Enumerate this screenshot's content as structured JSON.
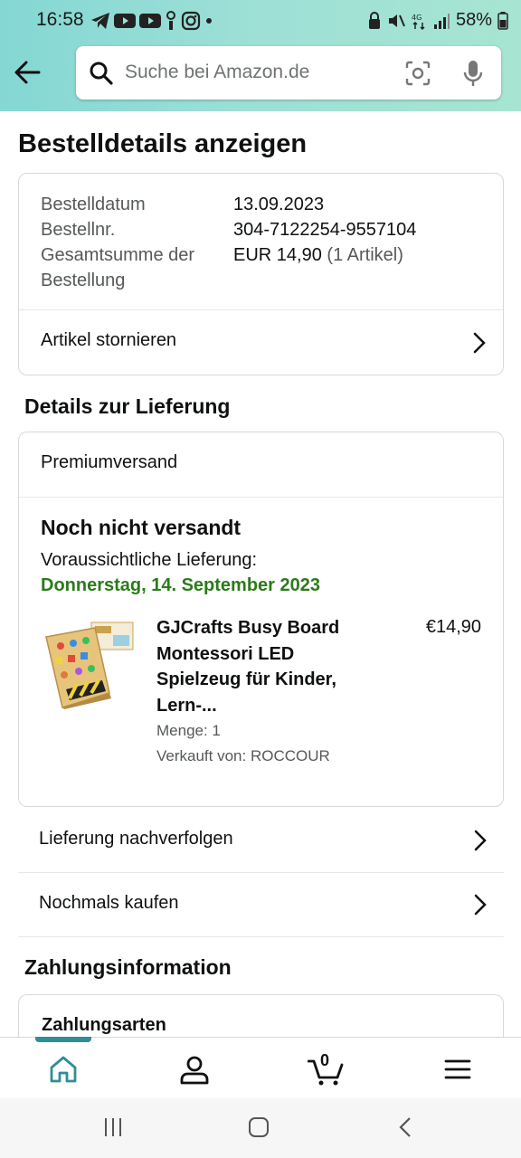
{
  "status_bar": {
    "time": "16:58",
    "battery": "58%"
  },
  "search": {
    "placeholder": "Suche bei Amazon.de"
  },
  "page_title": "Bestelldetails anzeigen",
  "order": {
    "date_label": "Bestelldatum",
    "date_value": "13.09.2023",
    "number_label": "Bestellnr.",
    "number_value": "304-7122254-9557104",
    "total_label_1": "Gesamtsumme der",
    "total_label_2": "Bestellung",
    "total_value": "EUR 14,90",
    "total_count": "(1 Artikel)",
    "cancel_label": "Artikel stornieren"
  },
  "delivery": {
    "section_title": "Details zur Lieferung",
    "shipping_type": "Premiumversand",
    "status": "Noch nicht versandt",
    "eta_label": "Voraussichtliche Lieferung:",
    "eta_date": "Donnerstag, 14. September 2023",
    "product": {
      "title": "GJCrafts Busy Board Montessori LED Spielzeug für Kinder, Lern-...",
      "price": "€14,90",
      "quantity": "Menge: 1",
      "seller": "Verkauft von: ROCCOUR"
    },
    "track_label": "Lieferung nachverfolgen",
    "buy_again_label": "Nochmals kaufen"
  },
  "payment": {
    "section_title": "Zahlungsinformation",
    "methods_label": "Zahlungsarten"
  },
  "bottom_nav": {
    "cart_count": "0"
  },
  "colors": {
    "accent_green": "#2b7b1a",
    "header_teal": "#9ee0d6",
    "nav_indicator": "#2f8f95"
  }
}
